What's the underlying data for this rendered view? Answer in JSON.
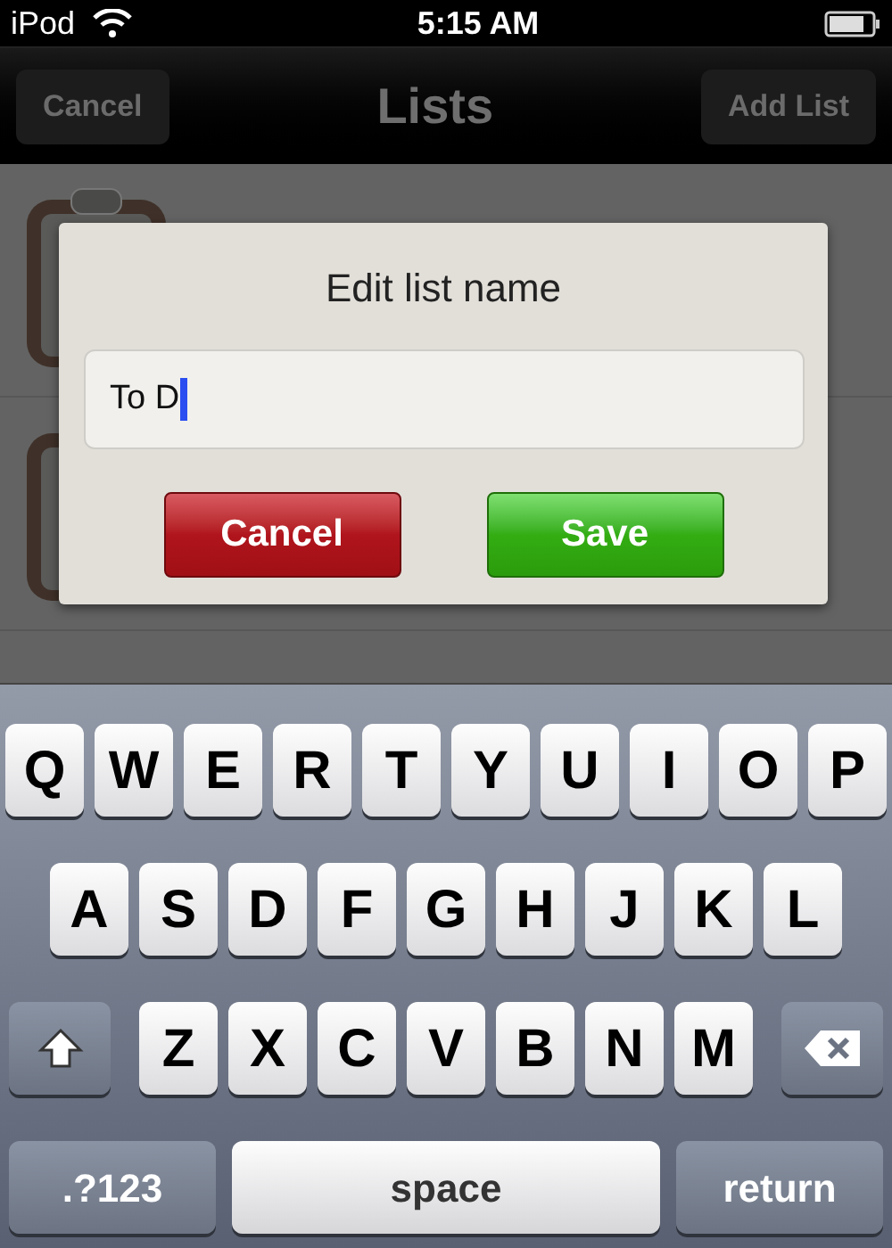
{
  "status_bar": {
    "carrier": "iPod",
    "time": "5:15 AM"
  },
  "nav_bar": {
    "left_button": "Cancel",
    "title": "Lists",
    "right_button": "Add List"
  },
  "dialog": {
    "title": "Edit list name",
    "field": {
      "value": "To D"
    },
    "buttons": [
      {
        "label": "Cancel",
        "kind": "destructive"
      },
      {
        "label": "Save",
        "kind": "confirm"
      }
    ]
  },
  "keyboard": {
    "rows": [
      {
        "keys": [
          {
            "label": "Q",
            "kind": "letter"
          },
          {
            "label": "W",
            "kind": "letter"
          },
          {
            "label": "E",
            "kind": "letter"
          },
          {
            "label": "R",
            "kind": "letter"
          },
          {
            "label": "T",
            "kind": "letter"
          },
          {
            "label": "Y",
            "kind": "letter"
          },
          {
            "label": "U",
            "kind": "letter"
          },
          {
            "label": "I",
            "kind": "letter"
          },
          {
            "label": "O",
            "kind": "letter"
          },
          {
            "label": "P",
            "kind": "letter"
          }
        ]
      },
      {
        "keys": [
          {
            "label": "A",
            "kind": "letter"
          },
          {
            "label": "S",
            "kind": "letter"
          },
          {
            "label": "D",
            "kind": "letter"
          },
          {
            "label": "F",
            "kind": "letter"
          },
          {
            "label": "G",
            "kind": "letter"
          },
          {
            "label": "H",
            "kind": "letter"
          },
          {
            "label": "J",
            "kind": "letter"
          },
          {
            "label": "K",
            "kind": "letter"
          },
          {
            "label": "L",
            "kind": "letter"
          }
        ]
      },
      {
        "keys": [
          {
            "kind": "shift"
          },
          {
            "label": "Z",
            "kind": "letter"
          },
          {
            "label": "X",
            "kind": "letter"
          },
          {
            "label": "C",
            "kind": "letter"
          },
          {
            "label": "V",
            "kind": "letter"
          },
          {
            "label": "B",
            "kind": "letter"
          },
          {
            "label": "N",
            "kind": "letter"
          },
          {
            "label": "M",
            "kind": "letter"
          },
          {
            "kind": "delete"
          }
        ]
      },
      {
        "keys": [
          {
            "label": ".?123",
            "kind": "mode"
          },
          {
            "label": "space",
            "kind": "space"
          },
          {
            "label": "return",
            "kind": "return"
          }
        ]
      }
    ]
  }
}
